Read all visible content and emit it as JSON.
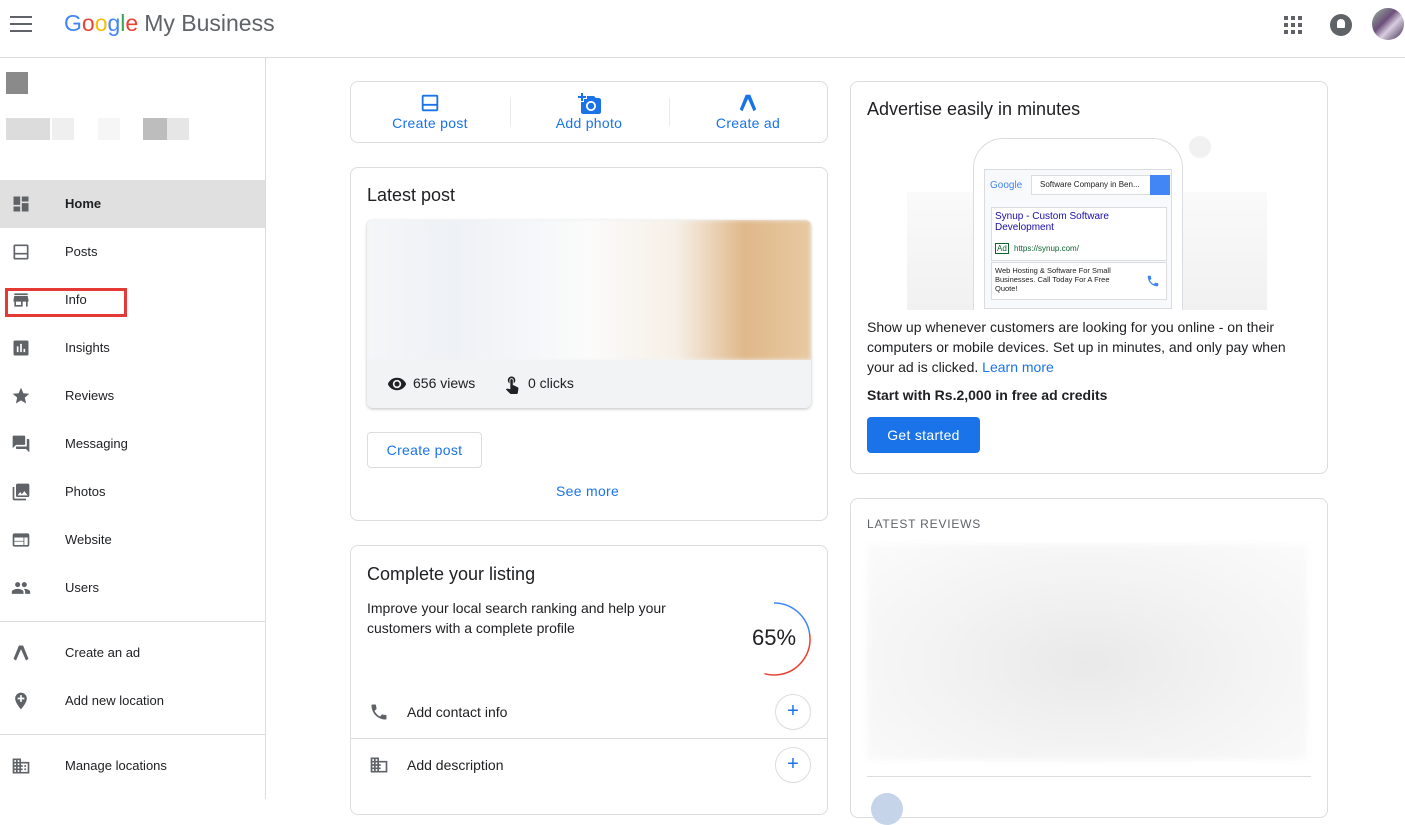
{
  "header": {
    "logo_google": [
      "G",
      "o",
      "o",
      "g",
      "l",
      "e"
    ],
    "product": "My Business"
  },
  "sidebar": {
    "items": [
      {
        "label": "Home",
        "icon": "dashboard-icon"
      },
      {
        "label": "Posts",
        "icon": "posts-icon"
      },
      {
        "label": "Info",
        "icon": "storefront-icon"
      },
      {
        "label": "Insights",
        "icon": "bar-chart-icon"
      },
      {
        "label": "Reviews",
        "icon": "star-icon"
      },
      {
        "label": "Messaging",
        "icon": "chat-icon"
      },
      {
        "label": "Photos",
        "icon": "photo-icon"
      },
      {
        "label": "Website",
        "icon": "web-icon"
      },
      {
        "label": "Users",
        "icon": "people-icon"
      }
    ],
    "secondary": [
      {
        "label": "Create an ad",
        "icon": "ads-icon"
      },
      {
        "label": "Add new location",
        "icon": "add-location-icon"
      }
    ],
    "manage": {
      "label": "Manage locations",
      "icon": "building-icon"
    }
  },
  "actions": {
    "create_post": "Create post",
    "add_photo": "Add photo",
    "create_ad": "Create ad"
  },
  "latest_post": {
    "title": "Latest post",
    "views": "656 views",
    "clicks": "0 clicks",
    "create_post": "Create post",
    "see_more": "See more"
  },
  "listing": {
    "title": "Complete your listing",
    "description": "Improve your local search ranking and help your customers with a complete profile",
    "progress_text": "65%",
    "progress": 0.65,
    "rows": [
      {
        "label": "Add contact info",
        "icon": "phone-icon"
      },
      {
        "label": "Add description",
        "icon": "business-icon"
      }
    ]
  },
  "advertise": {
    "title": "Advertise easily in minutes",
    "mock": {
      "search_query": "Software Company in Ben...",
      "google": "Google",
      "result_title": "Synup - Custom Software Development",
      "ad_badge": "Ad",
      "result_url": "https://synup.com/",
      "result_desc": "Web Hosting & Software For Small Businesses. Call Today For A Free Quote!"
    },
    "body": "Show up whenever customers are looking for you online - on their computers or mobile devices. Set up in minutes, and only pay when your ad is clicked.",
    "learn_more": "Learn more",
    "credits": "Start with Rs.2,000 in free ad credits",
    "cta": "Get started"
  },
  "reviews": {
    "caption": "LATEST REVIEWS"
  },
  "colors": {
    "accent": "#1a73e8",
    "highlight": "#e53935",
    "progress_blue": "#4285f4",
    "progress_red": "#ea4335"
  }
}
